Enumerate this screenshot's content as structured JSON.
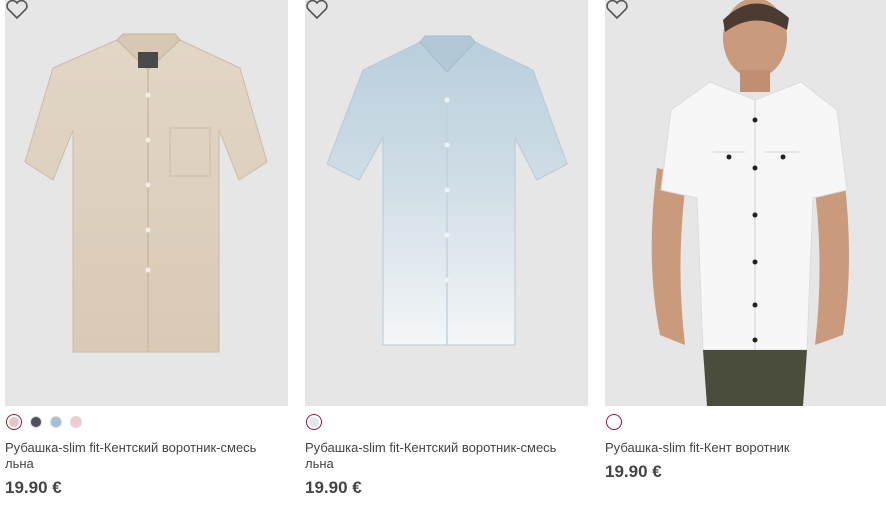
{
  "products": [
    {
      "name": "Рубашка-slim fit-Кентский воротник-смесь льна",
      "price": "19.90 €",
      "image": "beige-linen-shirt",
      "swatches": [
        {
          "color": "#e3c9c5",
          "selected": true
        },
        {
          "color": "#4b5162",
          "selected": false
        },
        {
          "color": "#a6bfd2",
          "selected": false
        },
        {
          "color": "#f0ccd2",
          "selected": false
        }
      ]
    },
    {
      "name": "Рубашка-slim fit-Кентский воротник-смесь льна",
      "price": "19.90 €",
      "image": "light-blue-ombre-shirt",
      "swatches": [
        {
          "color": "#e6e6e6",
          "selected": true
        }
      ]
    },
    {
      "name": "Рубашка-slim fit-Кент воротник",
      "price": "19.90 €",
      "image": "model-white-shirt",
      "swatches": [
        {
          "color": "#ffffff",
          "selected": true
        }
      ]
    }
  ],
  "colors": {
    "accent": "#8a1c3a",
    "image_bg": "#e6e6e6",
    "text": "#444444"
  },
  "icons": [
    "heart-icon"
  ]
}
